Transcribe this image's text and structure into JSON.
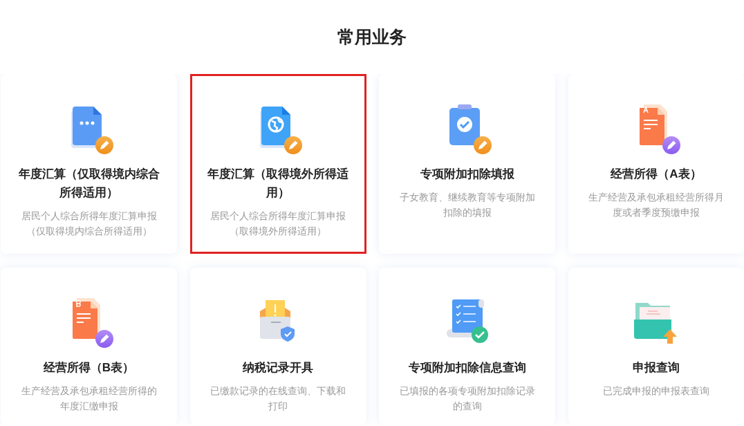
{
  "section_title": "常用业务",
  "cards": [
    {
      "title": "年度汇算（仅取得境内综合所得适用）",
      "description": "居民个人综合所得年度汇算申报（仅取得境内综合所得适用）",
      "selected": false
    },
    {
      "title": "年度汇算（取得境外所得适用）",
      "description": "居民个人综合所得年度汇算申报（取得境外所得适用）",
      "selected": true
    },
    {
      "title": "专项附加扣除填报",
      "description": "子女教育、继续教育等专项附加扣除的填报",
      "selected": false
    },
    {
      "title": "经营所得（A表）",
      "description": "生产经营及承包承租经营所得月度或者季度预缴申报",
      "selected": false
    },
    {
      "title": "经营所得（B表）",
      "description": "生产经营及承包承租经营所得的年度汇缴申报",
      "selected": false
    },
    {
      "title": "纳税记录开具",
      "description": "已缴款记录的在线查询、下载和打印",
      "selected": false
    },
    {
      "title": "专项附加扣除信息查询",
      "description": "已填报的各项专项附加扣除记录的查询",
      "selected": false
    },
    {
      "title": "申报查询",
      "description": "已完成申报的申报表查询",
      "selected": false
    }
  ]
}
